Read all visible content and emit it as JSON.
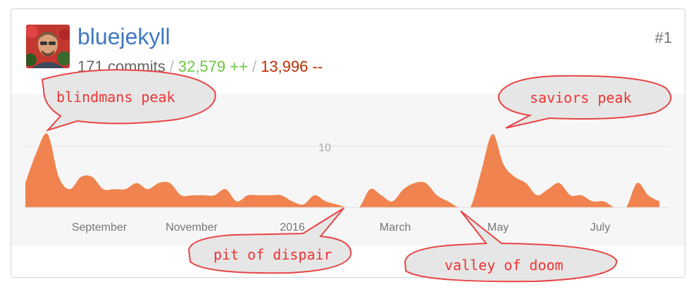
{
  "contributor": {
    "username": "bluejekyll",
    "rank": "#1",
    "commits": "171 commits",
    "separator": "/",
    "additions": "32,579 ++",
    "deletions": "13,996 --",
    "avatar_icon": "person-photo-avatar"
  },
  "colors": {
    "username": "#4078c0",
    "additions": "#6cc644",
    "deletions": "#bd2c00",
    "area": "#f0834f",
    "callout_text": "#ee3333"
  },
  "chart_data": {
    "type": "area",
    "x_tick_labels": [
      "September",
      "November",
      "2016",
      "March",
      "May",
      "July"
    ],
    "y_tick_labels": [
      "10"
    ],
    "ylim": [
      0,
      14
    ],
    "grid": true,
    "values": [
      4,
      9,
      12,
      5,
      3,
      5,
      5,
      3,
      3,
      3,
      4,
      3,
      4,
      4,
      2,
      2,
      2,
      2,
      3,
      1,
      2,
      2,
      2,
      2,
      1,
      0.5,
      2,
      1,
      0.5,
      0,
      0,
      3,
      2,
      1,
      3,
      4,
      4,
      2,
      1,
      0,
      0,
      6,
      12,
      7,
      5,
      4,
      2,
      3,
      4,
      2,
      2,
      1,
      1,
      0,
      0,
      4,
      2,
      1
    ]
  },
  "callouts": [
    {
      "label": "blindmans peak"
    },
    {
      "label": "saviors peak"
    },
    {
      "label": "pit of dispair"
    },
    {
      "label": "valley of doom"
    }
  ]
}
